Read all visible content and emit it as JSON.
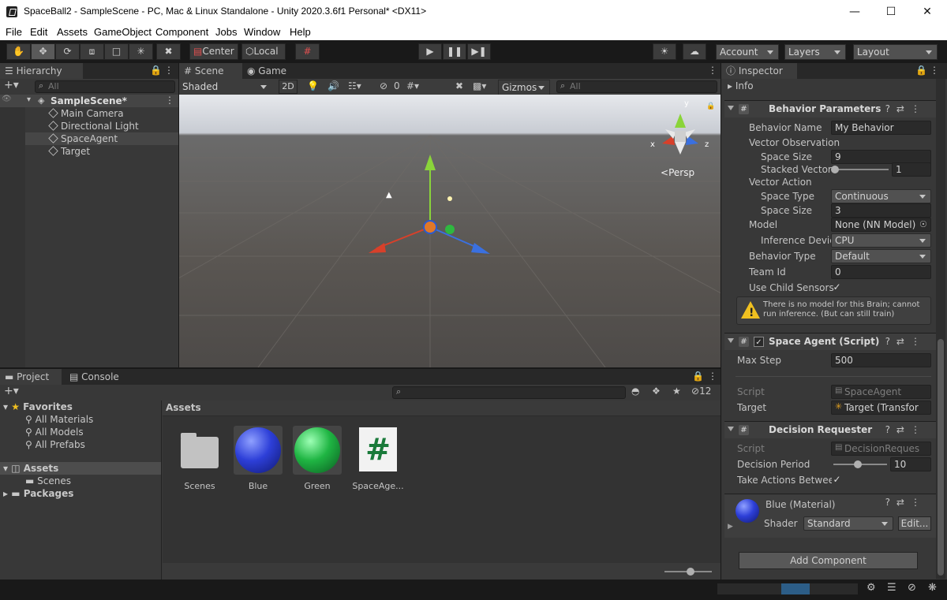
{
  "window": {
    "title": "SpaceBall2 - SampleScene - PC, Mac & Linux Standalone - Unity 2020.3.6f1 Personal* <DX11>",
    "minimize": "—",
    "maximize": "☐",
    "close": "✕"
  },
  "menu": [
    "File",
    "Edit",
    "Assets",
    "GameObject",
    "Component",
    "Jobs",
    "Window",
    "Help"
  ],
  "toolbar": {
    "tools": [
      "hand-tool",
      "move-tool",
      "rotate-tool",
      "scale-tool",
      "rect-tool",
      "transform-tool",
      "custom-tool"
    ],
    "pivot": "Center",
    "space": "Local",
    "account": "Account",
    "layers": "Layers",
    "layout": "Layout"
  },
  "hierarchy": {
    "tab": "Hierarchy",
    "search_placeholder": "All",
    "scene": "SampleScene*",
    "items": [
      "Main Camera",
      "Directional Light",
      "SpaceAgent",
      "Target"
    ]
  },
  "scene_view": {
    "tabs": [
      "Scene",
      "Game"
    ],
    "shading": "Shaded",
    "mode2d": "2D",
    "gizmos": "Gizmos",
    "search_placeholder": "All",
    "hidden_count": "0",
    "persp": "Persp",
    "axis_x": "x",
    "axis_y": "y",
    "axis_z": "z"
  },
  "inspector": {
    "tab": "Inspector",
    "info": "Info",
    "behavior_parameters": {
      "title": "Behavior Parameters",
      "behavior_name_label": "Behavior Name",
      "behavior_name": "My Behavior",
      "vector_observation": "Vector Observation",
      "space_size_label": "Space Size",
      "obs_space_size": "9",
      "stacked_label": "Stacked Vector",
      "stacked_value": "1",
      "vector_action": "Vector Action",
      "space_type_label": "Space Type",
      "space_type": "Continuous",
      "act_space_size": "3",
      "model_label": "Model",
      "model": "None (NN Model)",
      "inference_label": "Inference Devic",
      "inference": "CPU",
      "behavior_type_label": "Behavior Type",
      "behavior_type": "Default",
      "team_id_label": "Team Id",
      "team_id": "0",
      "child_sensors_label": "Use Child Sensors",
      "warning": "There is no model for this Brain; cannot run inference. (But can still train)"
    },
    "space_agent": {
      "title": "Space Agent (Script)",
      "max_step_label": "Max Step",
      "max_step": "500",
      "script_label": "Script",
      "script": "SpaceAgent",
      "target_label": "Target",
      "target": "Target (Transfor"
    },
    "decision_requester": {
      "title": "Decision Requester",
      "script_label": "Script",
      "script": "DecisionReques",
      "period_label": "Decision Period",
      "period": "10",
      "take_actions_label": "Take Actions Betwee"
    },
    "material": {
      "title": "Blue (Material)",
      "shader_label": "Shader",
      "shader": "Standard",
      "edit": "Edit..."
    },
    "add_component": "Add Component"
  },
  "project": {
    "tabs": [
      "Project",
      "Console"
    ],
    "hidden_count": "12",
    "favorites": "Favorites",
    "favorite_items": [
      "All Materials",
      "All Models",
      "All Prefabs"
    ],
    "assets_root": "Assets",
    "asset_folders": [
      "Scenes"
    ],
    "packages": "Packages",
    "breadcrumb": "Assets",
    "assets": [
      {
        "name": "Scenes",
        "kind": "folder"
      },
      {
        "name": "Blue",
        "kind": "material",
        "color": "#2d3fd8"
      },
      {
        "name": "Green",
        "kind": "material",
        "color": "#1fb543"
      },
      {
        "name": "SpaceAge...",
        "kind": "script"
      }
    ]
  },
  "colors": {
    "accent": "#2c5d87",
    "panel": "#383838",
    "toolbar": "#191919",
    "warning": "#f0c020"
  }
}
